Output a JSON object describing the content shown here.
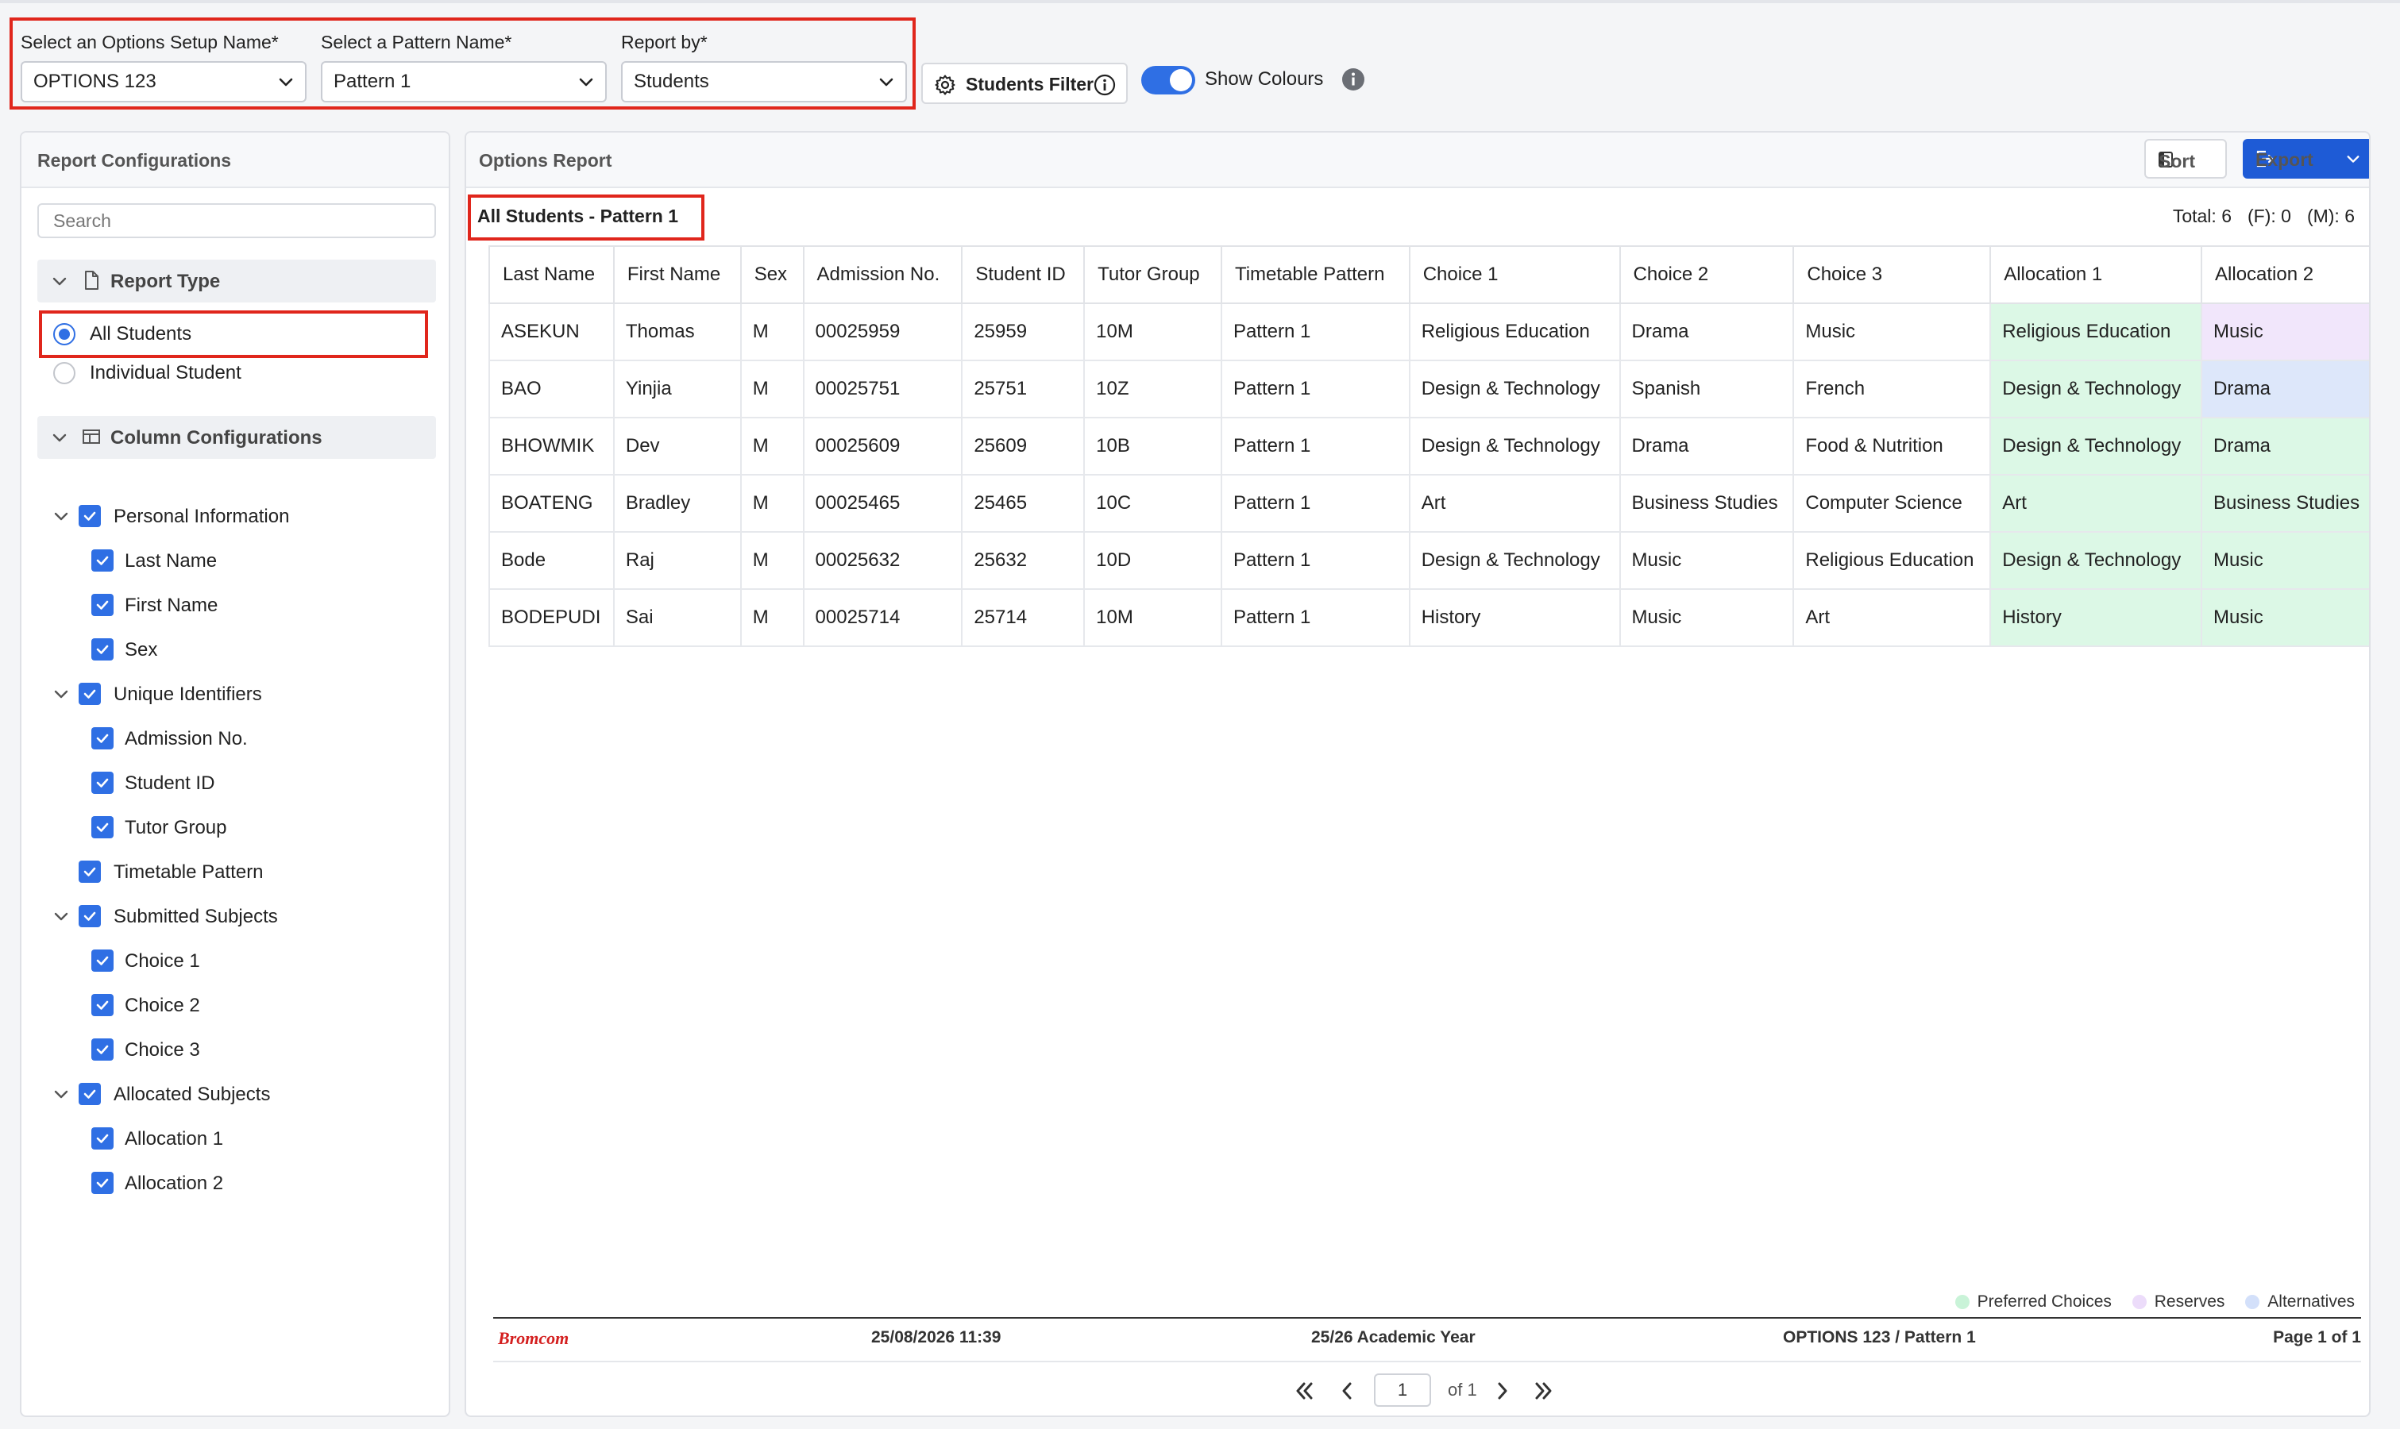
{
  "toolbar": {
    "options_setup_label": "Select an Options Setup Name*",
    "options_setup_value": "OPTIONS 123",
    "pattern_label": "Select a Pattern Name*",
    "pattern_value": "Pattern 1",
    "report_by_label": "Report by*",
    "report_by_value": "Students",
    "students_filter_label": "Students Filter",
    "show_colours_label": "Show Colours",
    "show_colours_on": true
  },
  "left_panel": {
    "title": "Report Configurations",
    "search_placeholder": "Search",
    "report_type": {
      "label": "Report Type",
      "options": [
        "All Students",
        "Individual Student"
      ],
      "selected": "All Students"
    },
    "column_configurations": {
      "label": "Column Configurations",
      "groups": [
        {
          "label": "Personal Information",
          "items": [
            "Last Name",
            "First Name",
            "Sex"
          ]
        },
        {
          "label": "Unique Identifiers",
          "items": [
            "Admission No.",
            "Student ID",
            "Tutor Group"
          ]
        },
        {
          "label": "Timetable Pattern",
          "items": []
        },
        {
          "label": "Submitted Subjects",
          "items": [
            "Choice 1",
            "Choice 2",
            "Choice 3"
          ]
        },
        {
          "label": "Allocated Subjects",
          "items": [
            "Allocation 1",
            "Allocation 2"
          ]
        }
      ]
    }
  },
  "report": {
    "title": "Options Report",
    "sort_label": "Sort",
    "export_label": "Export",
    "subtitle": "All Students - Pattern 1",
    "totals": {
      "total": "Total: 6",
      "female": "(F): 0",
      "male": "(M): 6"
    },
    "columns": [
      "Last Name",
      "First Name",
      "Sex",
      "Admission No.",
      "Student ID",
      "Tutor Group",
      "Timetable Pattern",
      "Choice 1",
      "Choice 2",
      "Choice 3",
      "Allocation 1",
      "Allocation 2"
    ],
    "rows": [
      [
        "ASEKUN",
        "Thomas",
        "M",
        "00025959",
        "25959",
        "10M",
        "Pattern 1",
        "Religious Education",
        "Drama",
        "Music",
        "Religious Education",
        "Music"
      ],
      [
        "BAO",
        "Yinjia",
        "M",
        "00025751",
        "25751",
        "10Z",
        "Pattern 1",
        "Design & Technology",
        "Spanish",
        "French",
        "Design & Technology",
        "Drama"
      ],
      [
        "BHOWMIK",
        "Dev",
        "M",
        "00025609",
        "25609",
        "10B",
        "Pattern 1",
        "Design & Technology",
        "Drama",
        "Food & Nutrition",
        "Design & Technology",
        "Drama"
      ],
      [
        "BOATENG",
        "Bradley",
        "M",
        "00025465",
        "25465",
        "10C",
        "Pattern 1",
        "Art",
        "Business Studies",
        "Computer Science",
        "Art",
        "Business Studies"
      ],
      [
        "Bode",
        "Raj",
        "M",
        "00025632",
        "25632",
        "10D",
        "Pattern 1",
        "Design & Technology",
        "Music",
        "Religious Education",
        "Design & Technology",
        "Music"
      ],
      [
        "BODEPUDI",
        "Sai",
        "M",
        "00025714",
        "25714",
        "10M",
        "Pattern 1",
        "History",
        "Music",
        "Art",
        "History",
        "Music"
      ]
    ],
    "allocation_colors": [
      [
        "preferred",
        "reserve"
      ],
      [
        "preferred",
        "alternative"
      ],
      [
        "preferred",
        "preferred"
      ],
      [
        "preferred",
        "preferred"
      ],
      [
        "preferred",
        "preferred"
      ],
      [
        "preferred",
        "preferred"
      ]
    ],
    "legend": [
      {
        "label": "Preferred Choices",
        "color": "#c9f3d8"
      },
      {
        "label": "Reserves",
        "color": "#ecdcfa"
      },
      {
        "label": "Alternatives",
        "color": "#d3e0fa"
      }
    ],
    "footer": {
      "brand": "Bromcom",
      "datetime": "25/08/2026 11:39",
      "academic_year": "25/26 Academic Year",
      "setup_pattern": "OPTIONS 123 / Pattern 1",
      "page_info": "Page 1 of 1"
    },
    "pager": {
      "current_page": "1",
      "of_label": "of 1"
    }
  },
  "colors": {
    "accent": "#2f6fe4",
    "export_button": "#1e5bd6",
    "highlight_border": "#e0261c",
    "preferred": "#dcf8e6",
    "reserve": "#f1e6fb",
    "alternative": "#dde7fa"
  }
}
